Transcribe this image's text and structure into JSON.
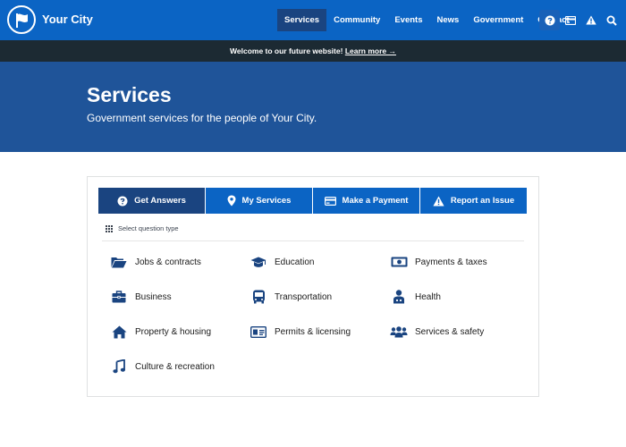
{
  "header": {
    "site_name": "Your City",
    "nav": [
      "Services",
      "Community",
      "Events",
      "News",
      "Government",
      "Contact"
    ],
    "active_nav": "Services",
    "icons": [
      "question-icon",
      "credit-card-icon",
      "warning-icon",
      "search-icon"
    ]
  },
  "banner": {
    "text": "Welcome to our future website!",
    "link": "Learn more →"
  },
  "hero": {
    "title": "Services",
    "subtitle": "Government services for the people of Your City."
  },
  "tabs": [
    {
      "label": "Get Answers",
      "icon": "question-icon",
      "active": true
    },
    {
      "label": "My Services",
      "icon": "map-marker-icon",
      "active": false
    },
    {
      "label": "Make a Payment",
      "icon": "credit-card-icon",
      "active": false
    },
    {
      "label": "Report an Issue",
      "icon": "warning-icon",
      "active": false
    }
  ],
  "select_label": "Select question type",
  "topics": [
    {
      "label": "Jobs & contracts",
      "icon": "folder-open-icon"
    },
    {
      "label": "Education",
      "icon": "graduation-cap-icon"
    },
    {
      "label": "Payments & taxes",
      "icon": "money-bill-icon"
    },
    {
      "label": "Business",
      "icon": "briefcase-icon"
    },
    {
      "label": "Transportation",
      "icon": "bus-icon"
    },
    {
      "label": "Health",
      "icon": "person-icon"
    },
    {
      "label": "Property & housing",
      "icon": "home-icon"
    },
    {
      "label": "Permits & licensing",
      "icon": "id-card-icon"
    },
    {
      "label": "Services & safety",
      "icon": "users-icon"
    },
    {
      "label": "Culture & recreation",
      "icon": "music-note-icon"
    }
  ],
  "colors": {
    "header_blue": "#0b64c4",
    "active_blue": "#1a4480",
    "hero_blue": "#1f5499",
    "banner_dark": "#1c2a33",
    "icon_blue": "#1a4480"
  }
}
